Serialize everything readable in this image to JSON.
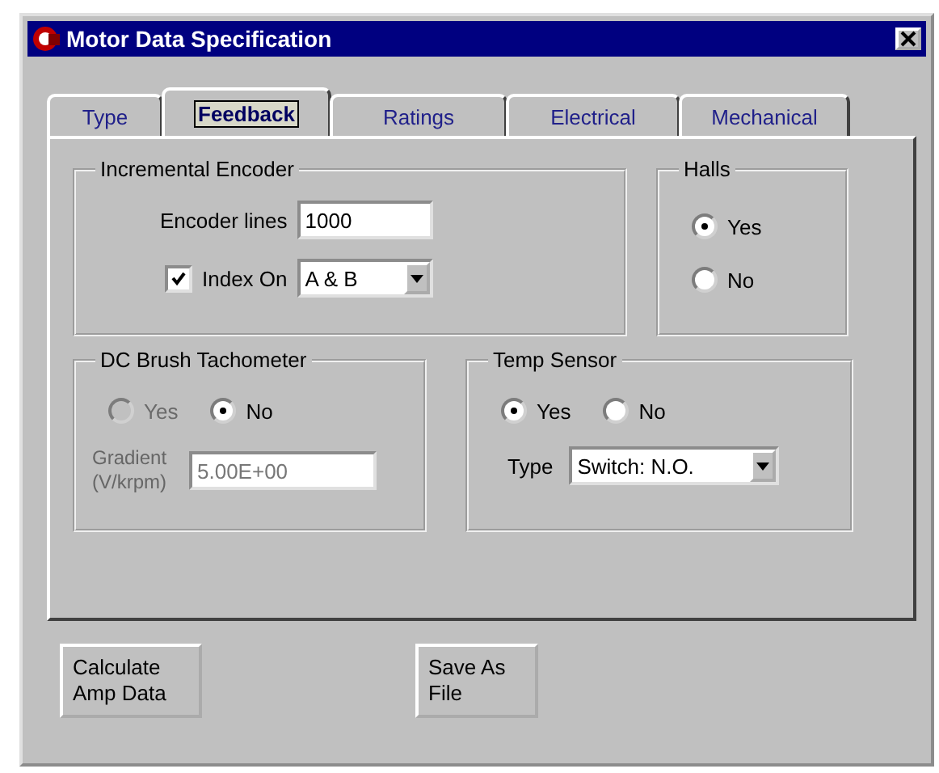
{
  "window": {
    "title": "Motor Data Specification"
  },
  "tabs": [
    {
      "label": "Type",
      "selected": false
    },
    {
      "label": "Feedback",
      "selected": true
    },
    {
      "label": "Ratings",
      "selected": false
    },
    {
      "label": "Electrical",
      "selected": false
    },
    {
      "label": "Mechanical",
      "selected": false
    }
  ],
  "incremental_encoder": {
    "title": "Incremental Encoder",
    "lines_label": "Encoder lines",
    "lines_value": "1000",
    "index": {
      "label": "Index On",
      "checked": true
    },
    "index_select": "A & B"
  },
  "halls": {
    "title": "Halls",
    "options": [
      {
        "label": "Yes",
        "selected": true
      },
      {
        "label": "No",
        "selected": false
      }
    ]
  },
  "tachometer": {
    "title": "DC Brush Tachometer",
    "options": [
      {
        "label": "Yes",
        "selected": false,
        "disabled": true
      },
      {
        "label": "No",
        "selected": true,
        "disabled": false
      }
    ],
    "gradient_label": "Gradient (V/krpm)",
    "gradient_value": "5.00E+00",
    "gradient_disabled": true
  },
  "temp_sensor": {
    "title": "Temp Sensor",
    "options": [
      {
        "label": "Yes",
        "selected": true
      },
      {
        "label": "No",
        "selected": false
      }
    ],
    "type_label": "Type",
    "type_value": "Switch: N.O."
  },
  "buttons": [
    {
      "label": "Calculate Amp Data"
    },
    {
      "label": "Save As File"
    }
  ]
}
